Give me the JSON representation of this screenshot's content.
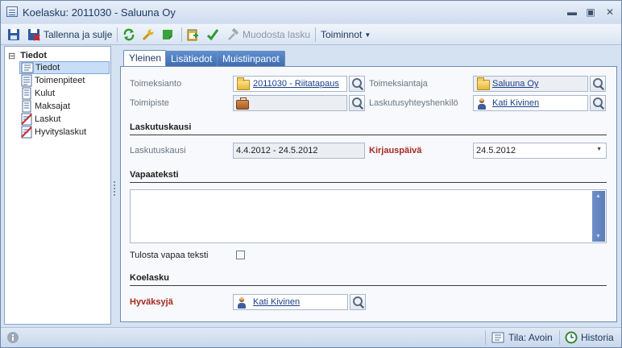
{
  "window": {
    "title": "Koelasku: 2011030 - Saluuna Oy",
    "minimize": "▬",
    "maximize": "▣",
    "close": "✕"
  },
  "toolbar": {
    "save_close_label": "Tallenna ja sulje",
    "create_invoice_label": "Muodosta lasku",
    "actions_label": "Toiminnot"
  },
  "tree": {
    "root": "Tiedot",
    "expander": "⊟",
    "items": [
      {
        "label": "Tiedot",
        "selected": true
      },
      {
        "label": "Toimenpiteet"
      },
      {
        "label": "Kulut"
      },
      {
        "label": "Maksajat"
      },
      {
        "label": "Laskut"
      },
      {
        "label": "Hyvityslaskut"
      }
    ]
  },
  "tabs": [
    "Yleinen",
    "Lisätiedot",
    "Muistiinpanot"
  ],
  "form": {
    "toimeksianto_label": "Toimeksianto",
    "toimeksianto_value": "2011030 - Riitatapaus",
    "toimipiste_label": "Toimipiste",
    "toimipiste_value": "",
    "toimeksiantaja_label": "Toimeksiantaja",
    "toimeksiantaja_value": "Saluuna Oy",
    "yhteyshenkilo_label": "Laskutusyhteyshenkilö",
    "yhteyshenkilo_value": "Kati Kivinen",
    "laskutuskausi_section": "Laskutuskausi",
    "laskutuskausi_label": "Laskutuskausi",
    "laskutuskausi_value": "4.4.2012 - 24.5.2012",
    "kirjauspaiva_label": "Kirjauspäivä",
    "kirjauspaiva_value": "24.5.2012",
    "vapaateksti_section": "Vapaateksti",
    "vapaateksti_value": "",
    "tulosta_label": "Tulosta vapaa teksti",
    "tulosta_checked": false,
    "koelasku_section": "Koelasku",
    "hyvaksyja_label": "Hyväksyjä",
    "hyvaksyja_value": "Kati Kivinen"
  },
  "statusbar": {
    "info_icon": "info-icon",
    "status_label": "Tila: Avoin",
    "history_label": "Historia"
  },
  "colors": {
    "required_label": "#a52a1f",
    "link": "#1a3f8a",
    "tab_inactive": "#4d7cc0"
  }
}
